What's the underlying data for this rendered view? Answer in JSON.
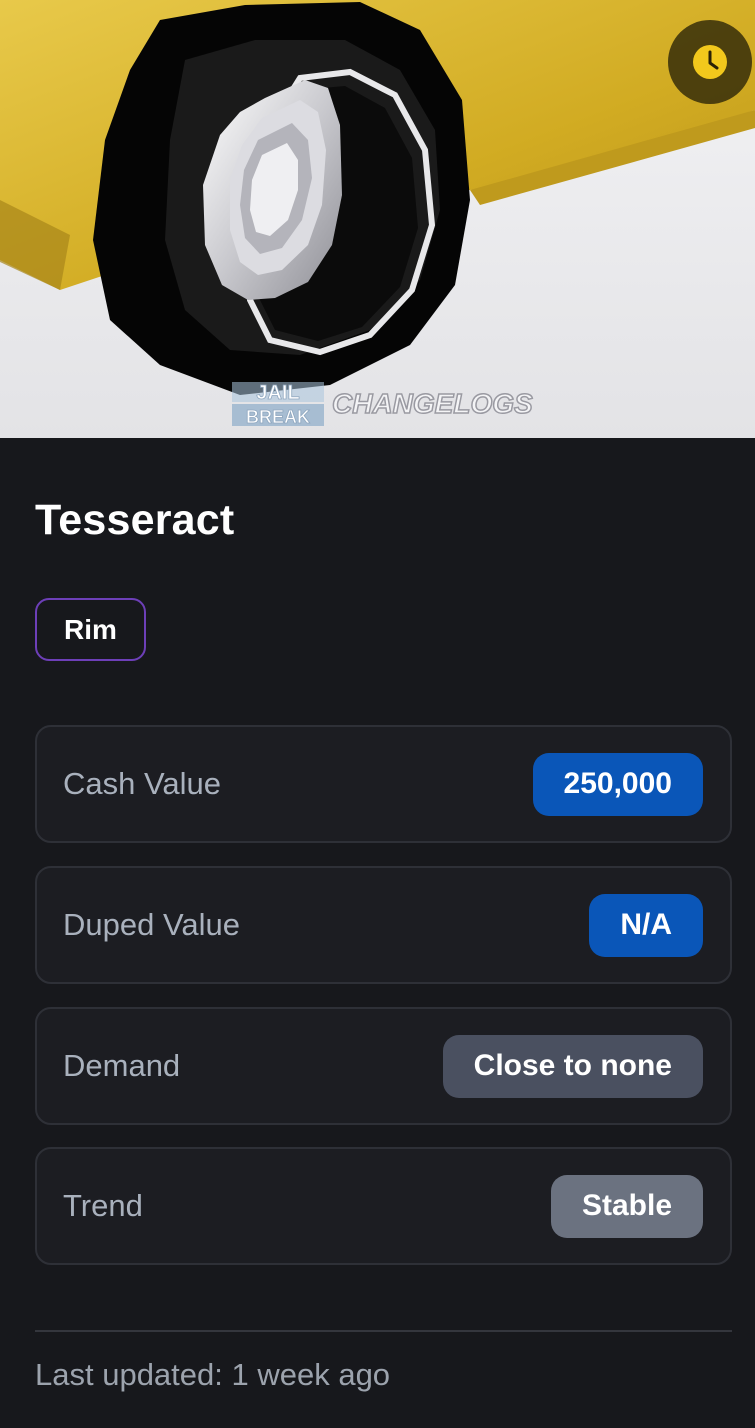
{
  "item": {
    "name": "Tesseract",
    "type": "Rim",
    "type_border_color": "#6d3fb8",
    "image_watermark": {
      "logo_top": "JAIL",
      "logo_bottom": "BREAK",
      "text": "CHANGELOGS"
    },
    "history_icon": "clock-icon"
  },
  "stats": [
    {
      "label": "Cash Value",
      "value": "250,000",
      "color": "#0a56b8"
    },
    {
      "label": "Duped Value",
      "value": "N/A",
      "color": "#0a56b8"
    },
    {
      "label": "Demand",
      "value": "Close to none",
      "color": "#4a5060"
    },
    {
      "label": "Trend",
      "value": "Stable",
      "color": "#6b7280"
    }
  ],
  "footer": {
    "last_updated": "Last updated: 1 week ago"
  }
}
